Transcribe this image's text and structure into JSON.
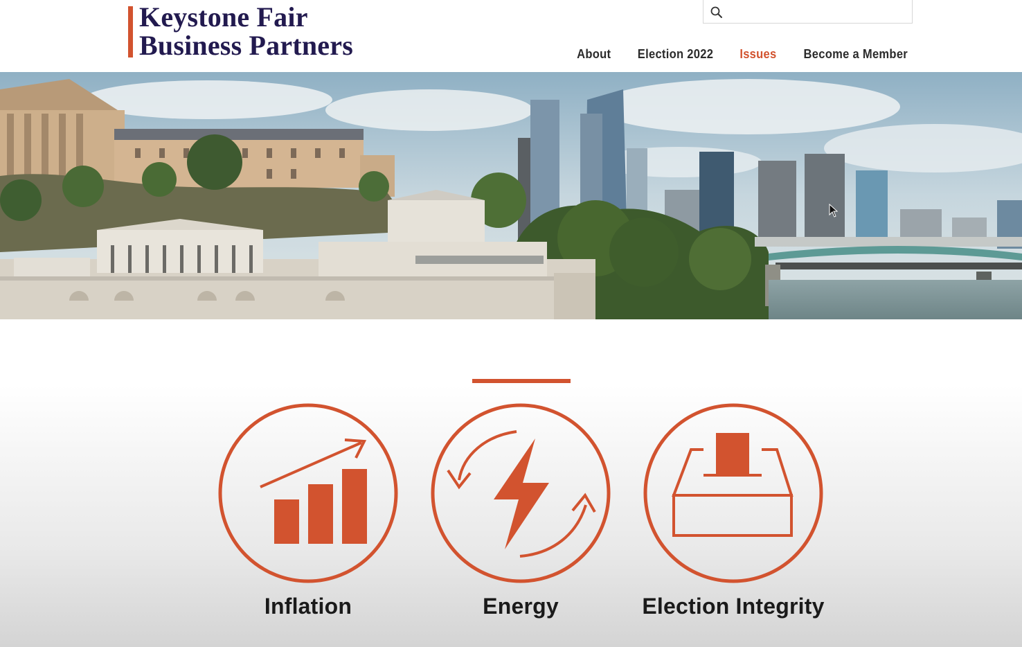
{
  "brand": {
    "line1": "Keystone Fair",
    "line2": "Business Partners",
    "accent_color": "#d2532f",
    "text_color": "#221a4f"
  },
  "search": {
    "placeholder": "",
    "value": "",
    "icon": "search-icon"
  },
  "nav": {
    "items": [
      {
        "label": "About"
      },
      {
        "label": "Election 2022"
      },
      {
        "label": "Issues",
        "active": true
      },
      {
        "label": "Become a Member"
      }
    ]
  },
  "hero": {
    "image": "philadelphia-skyline-photo"
  },
  "issues": {
    "items": [
      {
        "label": "Inflation",
        "icon": "rising-bar-chart-icon"
      },
      {
        "label": "Energy",
        "icon": "lightning-cycle-icon"
      },
      {
        "label": "Election Integrity",
        "icon": "ballot-box-icon"
      }
    ]
  }
}
